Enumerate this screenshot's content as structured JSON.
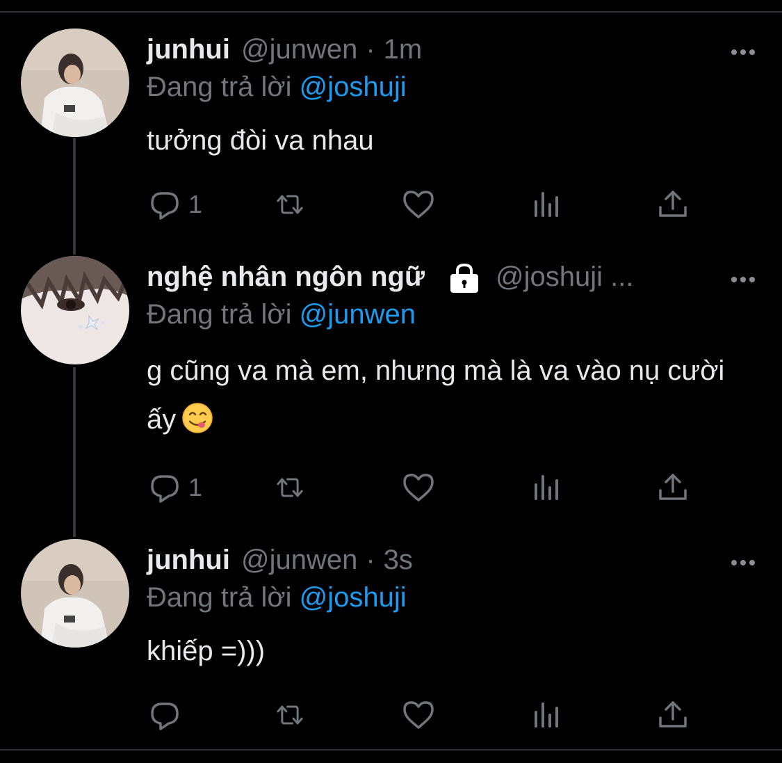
{
  "tweets": [
    {
      "name": "junhui",
      "handle": "@junwen",
      "dot": "·",
      "time": "1m",
      "replying_prefix": "Đang trả lời",
      "replying_to": "@joshuji",
      "text": "tưởng đòi va nhau",
      "reply_count": "1",
      "avatar_icon": "avatar-junhui",
      "more_icon": "more-horizontal-icon"
    },
    {
      "name": "nghệ nhân ngôn ngữ",
      "handle": "@joshuji ...",
      "protected_icon": "lock-icon",
      "replying_prefix": "Đang trả lời",
      "replying_to": "@junwen",
      "text": "g cũng va mà em, nhưng mà là va vào nụ cười ấy",
      "emoji": "savoring-food-emoji",
      "reply_count": "1",
      "avatar_icon": "avatar-joshuji",
      "more_icon": "more-horizontal-icon"
    },
    {
      "name": "junhui",
      "handle": "@junwen",
      "dot": "·",
      "time": "3s",
      "replying_prefix": "Đang trả lời",
      "replying_to": "@joshuji",
      "text": "khiếp =)))",
      "reply_count": "",
      "avatar_icon": "avatar-junhui",
      "more_icon": "more-horizontal-icon"
    }
  ],
  "action_icons": [
    "reply-icon",
    "retweet-icon",
    "like-icon",
    "analytics-icon",
    "share-icon"
  ],
  "colors": {
    "background": "#000000",
    "text": "#e7e9ea",
    "secondary": "#71767b",
    "mention": "#1d9bf0",
    "thread_line": "#333639"
  }
}
